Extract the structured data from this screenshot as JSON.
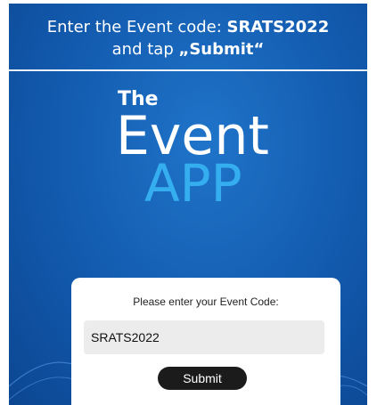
{
  "instruction": {
    "line1_prefix": "Enter the Event code: ",
    "line1_code": "SRATS2022",
    "line2_prefix": "and tap ",
    "line2_action": "„Submit“"
  },
  "logo": {
    "the": "The",
    "event": "Event",
    "app": "APP"
  },
  "form": {
    "label": "Please enter your Event Code:",
    "code_value": "SRATS2022",
    "submit_label": "Submit"
  },
  "colors": {
    "background": "#125aae",
    "app_accent": "#35aef0",
    "button": "#1b1b1b",
    "input_bg": "#ececec"
  }
}
